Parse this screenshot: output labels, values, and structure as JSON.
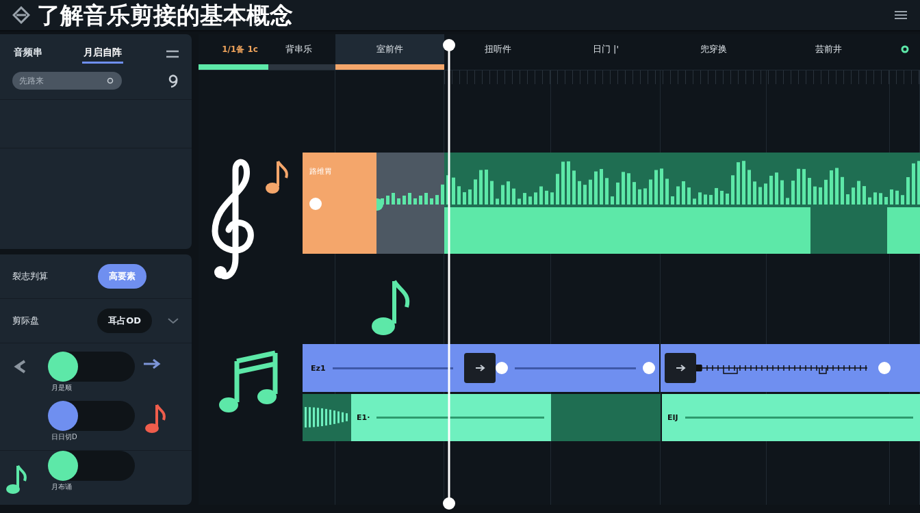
{
  "header": {
    "title": "了解音乐剪接的基本概念"
  },
  "sidebar": {
    "tabs": [
      {
        "label": "音频串",
        "selected": false
      },
      {
        "label": "月启自阵",
        "selected": true
      }
    ],
    "search": {
      "placeholder": "先路来"
    },
    "settings": [
      {
        "kind": "button",
        "label": "裂志判算",
        "value": "高要素"
      },
      {
        "kind": "dropdown",
        "label": "剪际盘",
        "value": "耳占OD"
      }
    ],
    "toggles": [
      {
        "label": "月是顺",
        "color": "#5de8a8"
      },
      {
        "label": "日日切D",
        "color": "#6f8ff0"
      },
      {
        "label": "月布诵",
        "color": "#5de8a8"
      }
    ]
  },
  "timeline": {
    "counter": "1/1备 1c",
    "columns": [
      {
        "label": "背串乐",
        "selected": false,
        "level": 0.51
      },
      {
        "label": "室前件",
        "selected": true,
        "level": 1
      },
      {
        "label": "扭听件",
        "selected": false
      },
      {
        "label": "日门 |'",
        "selected": false
      },
      {
        "label": "兜穿换",
        "selected": false
      },
      {
        "label": "芸前井",
        "selected": false
      }
    ],
    "audio_clip": {
      "label": "路维胃"
    },
    "blue_track": {
      "label": "Ez1"
    },
    "green_track": {
      "labels": [
        "E1·",
        "EIJ"
      ]
    }
  }
}
